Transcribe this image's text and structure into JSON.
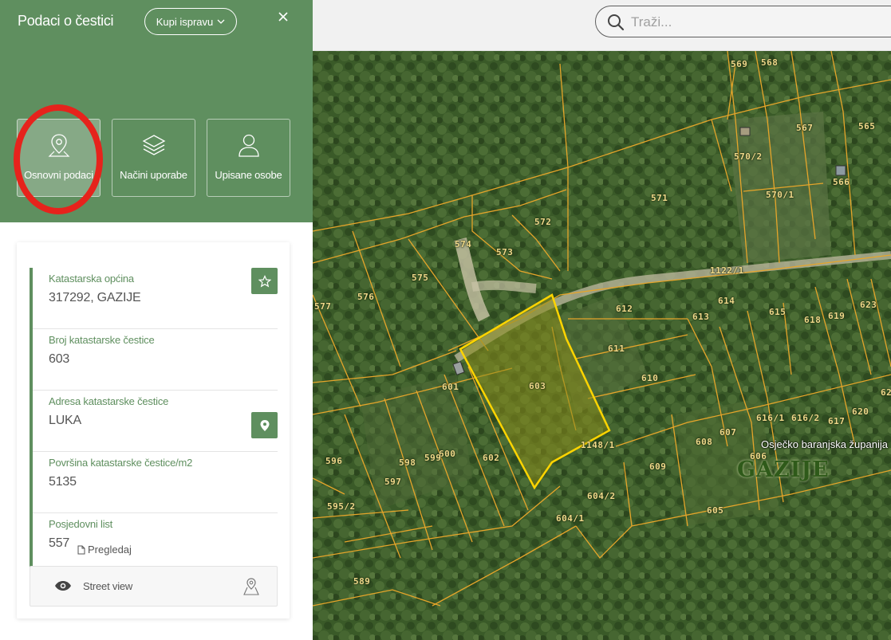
{
  "sidebar": {
    "title": "Podaci o čestici",
    "buy_button": "Kupi ispravu",
    "tabs": [
      {
        "label": "Osnovni podaci",
        "icon": "map-pin-icon",
        "active": true
      },
      {
        "label": "Načini uporabe",
        "icon": "layers-icon",
        "active": false
      },
      {
        "label": "Upisane osobe",
        "icon": "person-icon",
        "active": false
      }
    ],
    "fields": [
      {
        "label": "Katastarska općina",
        "value": "317292, GAZIJE"
      },
      {
        "label": "Broj katastarske čestice",
        "value": "603"
      },
      {
        "label": "Adresa katastarske čestice",
        "value": "LUKA"
      },
      {
        "label": "Površina katastarske čestice/m2",
        "value": "5135"
      },
      {
        "label": "Posjedovni list",
        "value": "557",
        "link": "Pregledaj"
      }
    ],
    "street_view": "Street view"
  },
  "search": {
    "placeholder": "Traži..."
  },
  "map": {
    "place_name": "GAZIJE",
    "county_name": "Osječko baranjska županija",
    "parcel_labels": [
      "569",
      "568",
      "567",
      "565",
      "570/2",
      "566",
      "570/1",
      "571",
      "572",
      "574",
      "573",
      "575",
      "576",
      "577",
      "1122/1",
      "612",
      "614",
      "615",
      "618",
      "619",
      "623",
      "613",
      "611",
      "601",
      "603",
      "610",
      "616/1",
      "616/2",
      "620",
      "617",
      "62",
      "600",
      "602",
      "1148/1",
      "608",
      "607",
      "606",
      "596",
      "598",
      "599",
      "609",
      "597",
      "595/2",
      "604/2",
      "604/1",
      "605",
      "589"
    ],
    "selected_parcel": "603",
    "colors": {
      "parcel_line": "#e6a52a",
      "selected_fill": "#8b8c1c",
      "selected_line": "#ffd400",
      "sidebar_green": "#5f8f5f"
    }
  }
}
